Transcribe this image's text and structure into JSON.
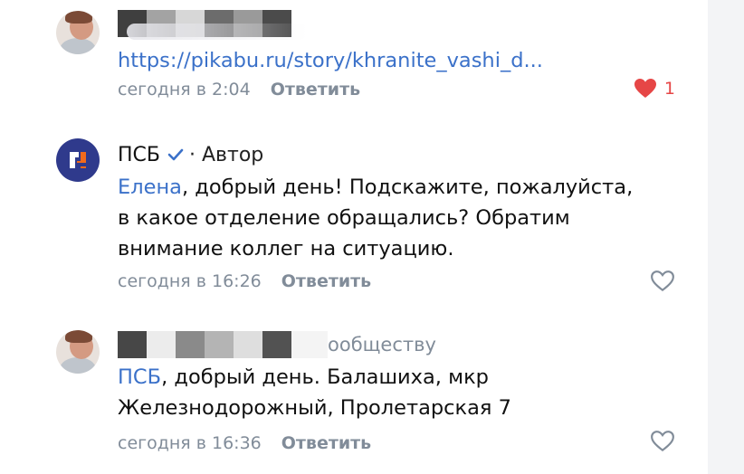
{
  "comments": [
    {
      "author_hidden": true,
      "link_text": "https://pikabu.ru/story/khranite_vashi_d...",
      "time": "сегодня в 2:04",
      "reply_label": "Ответить",
      "likes": "1",
      "liked": true
    },
    {
      "author": "ПСБ",
      "verified_icon": "checkmark-icon",
      "role": "· Автор",
      "mention": "Елена",
      "text_lines": [
        ", добрый день! Подскажите, пожалуйста,",
        "в какое отделение обращались? Обратим",
        "внимание коллег на ситуацию."
      ],
      "time": "сегодня в 16:26",
      "reply_label": "Ответить",
      "liked": false
    },
    {
      "author_hidden": true,
      "author_suffix": "ообществу",
      "mention": "ПСБ",
      "text_lines": [
        ", добрый день. Балашиха, мкр",
        "Железнодорожный, Пролетарская 7"
      ],
      "time": "сегодня в 16:36",
      "reply_label": "Ответить",
      "liked": false
    }
  ],
  "colors": {
    "link": "#3b71c9",
    "meta": "#818c99",
    "like": "#e64646",
    "psb_brand": "#2f3a8c"
  }
}
